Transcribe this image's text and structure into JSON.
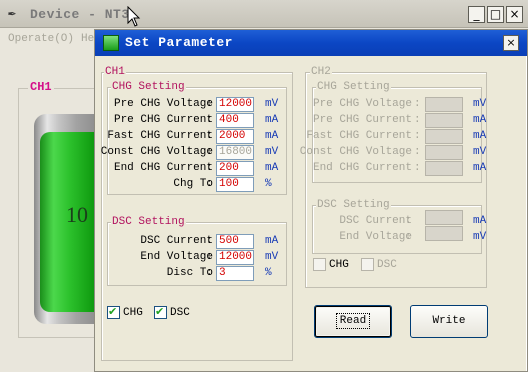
{
  "background_window": {
    "title": "Device - NT3",
    "menu": [
      "Operate(O)",
      "He"
    ],
    "ch1_label": "CH1",
    "battery_percent_text": "10",
    "buttons": {
      "minimize": "_",
      "maximize": "□",
      "close": "×"
    }
  },
  "dialog": {
    "title": "Set Parameter",
    "close": "×",
    "ch1": {
      "label": "CH1",
      "chg": {
        "label": "CHG Setting",
        "rows": [
          {
            "label": "Pre CHG Voltage",
            "value": "12000",
            "unit": "mV"
          },
          {
            "label": "Pre CHG Current",
            "value": "400",
            "unit": "mA"
          },
          {
            "label": "Fast CHG Current",
            "value": "2000",
            "unit": "mA"
          },
          {
            "label": "Const CHG Voltage",
            "value": "16800",
            "unit": "mV"
          },
          {
            "label": "End CHG Current",
            "value": "200",
            "unit": "mA"
          },
          {
            "label": "Chg To",
            "value": "100",
            "unit": "%"
          }
        ]
      },
      "dsc": {
        "label": "DSC Setting",
        "rows": [
          {
            "label": "DSC Current",
            "value": "500",
            "unit": "mA"
          },
          {
            "label": "End Voltage",
            "value": "12000",
            "unit": "mV"
          },
          {
            "label": "Disc To",
            "value": "3",
            "unit": "%"
          }
        ]
      },
      "checkboxes": [
        {
          "label": "CHG",
          "checked": true
        },
        {
          "label": "DSC",
          "checked": true
        }
      ]
    },
    "ch2": {
      "label": "CH2",
      "chg": {
        "label": "CHG Setting",
        "rows": [
          {
            "label": "Pre CHG Voltage",
            "value": "",
            "unit": "mV"
          },
          {
            "label": "Pre CHG Current",
            "value": "",
            "unit": "mA"
          },
          {
            "label": "Fast CHG Current",
            "value": "",
            "unit": "mA"
          },
          {
            "label": "Const CHG Voltage",
            "value": "",
            "unit": "mV"
          },
          {
            "label": "End CHG Current",
            "value": "",
            "unit": "mA"
          }
        ]
      },
      "dsc": {
        "label": "DSC Setting",
        "rows": [
          {
            "label": "DSC Current",
            "value": "",
            "unit": "mA"
          },
          {
            "label": "End Voltage",
            "value": "",
            "unit": "mV"
          }
        ]
      },
      "checkboxes": [
        {
          "label": "CHG",
          "checked": false
        },
        {
          "label": "DSC",
          "checked": false
        }
      ]
    },
    "buttons": {
      "read": "Read",
      "write": "Write"
    }
  }
}
